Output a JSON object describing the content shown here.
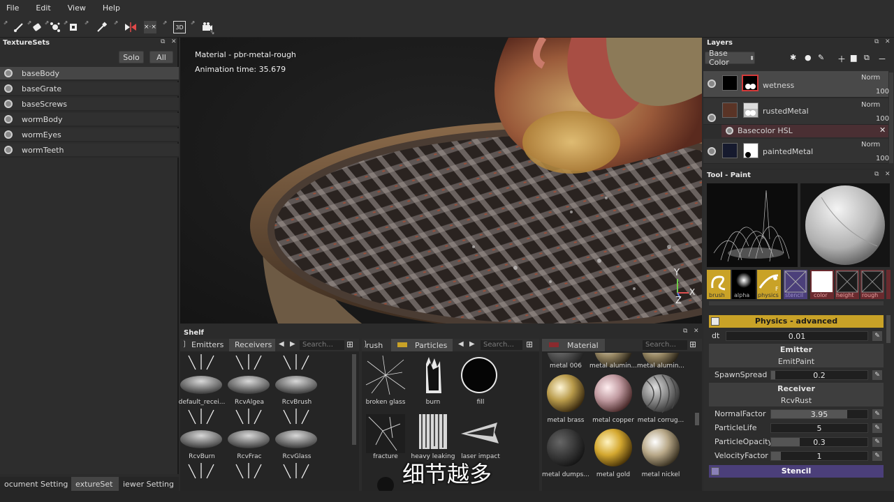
{
  "menu": [
    "File",
    "Edit",
    "View",
    "Help"
  ],
  "texturesets": {
    "title": "TextureSets",
    "solo_label": "Solo",
    "all_label": "All",
    "items": [
      "baseBody",
      "baseGrate",
      "baseScrews",
      "wormBody",
      "wormEyes",
      "wormTeeth"
    ]
  },
  "bottom_tabs": [
    "ocument Setting",
    "extureSet",
    "iewer Setting"
  ],
  "viewport": {
    "material_line": "Material - pbr-metal-rough",
    "animation_line": "Animation time: 35.679",
    "axis_y": "Y",
    "axis_x": "X",
    "axis_z": "Z"
  },
  "shelf": {
    "title": "Shelf",
    "col1": {
      "tabs": [
        "Emitters",
        "Receivers"
      ],
      "search_placeholder": "Search...",
      "items": [
        "default_recei...",
        "RcvAlgea",
        "RcvBrush",
        "RcvBurn",
        "RcvFrac",
        "RcvGlass"
      ]
    },
    "col2": {
      "tabs": [
        "rush",
        "Particles"
      ],
      "search_placeholder": "Search...",
      "items": [
        "broken glass",
        "burn",
        "fill",
        "fracture",
        "heavy leaking",
        "laser impact"
      ]
    },
    "col3": {
      "tab": "Material",
      "search_placeholder": "Search...",
      "items": [
        "metal 006",
        "metal alumin...",
        "metal alumin...",
        "metal brass",
        "metal copper",
        "metal corrug...",
        "metal dumps...",
        "metal gold",
        "metal nickel"
      ]
    }
  },
  "layers": {
    "title": "Layers",
    "channel": "Base Color",
    "items": [
      {
        "name": "wetness",
        "blend": "Norm",
        "opacity": "100"
      },
      {
        "name": "rustedMetal",
        "blend": "Norm",
        "opacity": "100"
      },
      {
        "name": "Basecolor HSL",
        "blend": "",
        "opacity": ""
      },
      {
        "name": "paintedMetal",
        "blend": "Norm",
        "opacity": "100"
      }
    ]
  },
  "tool": {
    "title": "Tool - Paint",
    "slot_labels": [
      "brush",
      "alpha",
      "physics",
      "stencil",
      "color",
      "height",
      "rough"
    ],
    "physics_header": "Physics - advanced",
    "dt_label": "dt",
    "dt_value": "0.01",
    "emitter_header": "Emitter",
    "emitter_name": "EmitPaint",
    "spawn_label": "SpawnSpread",
    "spawn_value": "0.2",
    "receiver_header": "Receiver",
    "receiver_name": "RcvRust",
    "params": [
      {
        "label": "NormalFactor",
        "value": "3.95",
        "fill": 0.79
      },
      {
        "label": "ParticleLife",
        "value": "5",
        "fill": 0.0
      },
      {
        "label": "ParticleOpacity",
        "value": "0.3",
        "fill": 0.3
      },
      {
        "label": "VelocityFactor",
        "value": "1",
        "fill": 0.1
      }
    ],
    "stencil_header": "Stencil"
  },
  "subtitle": "细节越多",
  "colors": {
    "physics_header": "#c9a227",
    "stencil_header": "#4b3f7a",
    "hsl_row": "#4a2f33"
  }
}
